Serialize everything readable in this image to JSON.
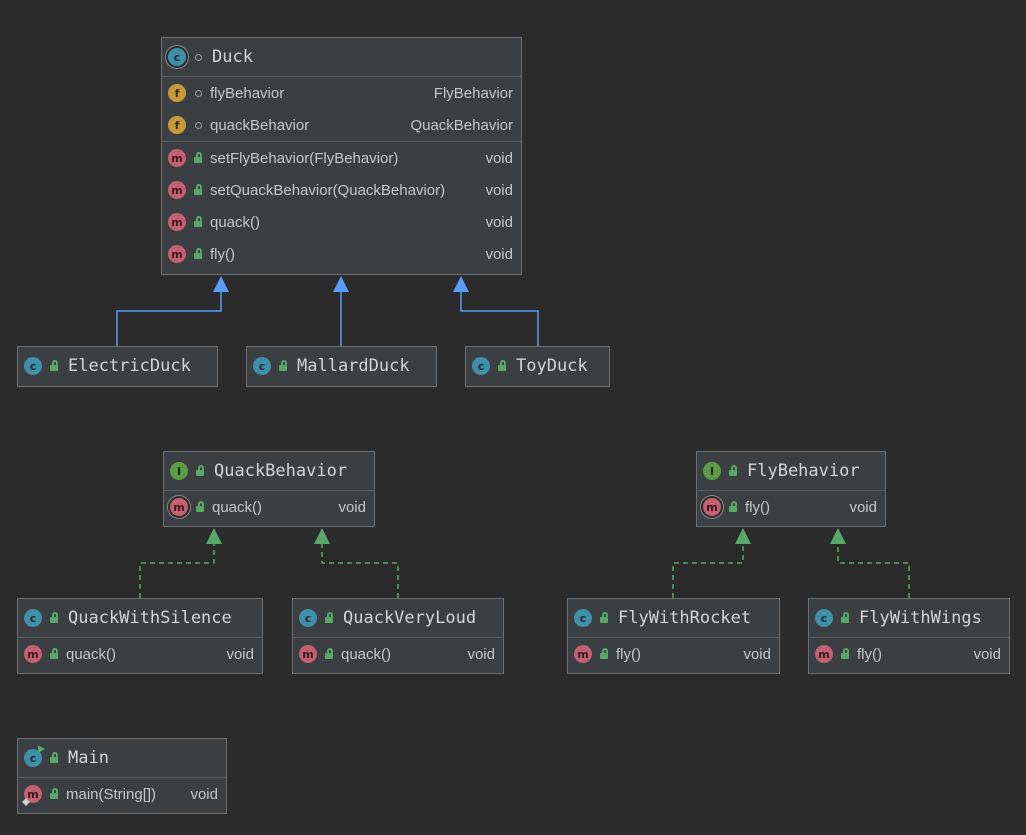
{
  "colors": {
    "background": "#2b2b2b",
    "node_fill": "#3c3f41",
    "extends_edge": "#589df6",
    "implements_edge": "#59a869"
  },
  "duck": {
    "name": "Duck",
    "fields": [
      {
        "name": "flyBehavior",
        "type": "FlyBehavior"
      },
      {
        "name": "quackBehavior",
        "type": "QuackBehavior"
      }
    ],
    "methods": [
      {
        "name": "setFlyBehavior(FlyBehavior)",
        "type": "void"
      },
      {
        "name": "setQuackBehavior(QuackBehavior)",
        "type": "void"
      },
      {
        "name": "quack()",
        "type": "void"
      },
      {
        "name": "fly()",
        "type": "void"
      }
    ]
  },
  "electric_duck": {
    "name": "ElectricDuck"
  },
  "mallard_duck": {
    "name": "MallardDuck"
  },
  "toy_duck": {
    "name": "ToyDuck"
  },
  "quack_behavior": {
    "name": "QuackBehavior",
    "methods": [
      {
        "name": "quack()",
        "type": "void"
      }
    ]
  },
  "fly_behavior": {
    "name": "FlyBehavior",
    "methods": [
      {
        "name": "fly()",
        "type": "void"
      }
    ]
  },
  "quack_with_silence": {
    "name": "QuackWithSilence",
    "methods": [
      {
        "name": "quack()",
        "type": "void"
      }
    ]
  },
  "quack_very_loud": {
    "name": "QuackVeryLoud",
    "methods": [
      {
        "name": "quack()",
        "type": "void"
      }
    ]
  },
  "fly_with_rocket": {
    "name": "FlyWithRocket",
    "methods": [
      {
        "name": "fly()",
        "type": "void"
      }
    ]
  },
  "fly_with_wings": {
    "name": "FlyWithWings",
    "methods": [
      {
        "name": "fly()",
        "type": "void"
      }
    ]
  },
  "main": {
    "name": "Main",
    "methods": [
      {
        "name": "main(String[])",
        "type": "void"
      }
    ]
  },
  "badges": {
    "class": "c",
    "field": "f",
    "method": "m",
    "interface": "I"
  }
}
